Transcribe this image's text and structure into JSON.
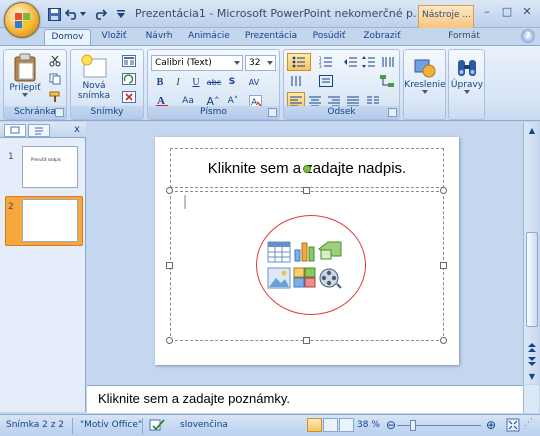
{
  "window": {
    "title": "Prezentácia1 - Microsoft PowerPoint nekomerčné p...",
    "context_tab": "Nástroje ...",
    "buttons": {
      "minimize": "–",
      "maximize": "□",
      "close": "✕"
    }
  },
  "quick_access": {
    "items": [
      "save-icon",
      "undo-icon",
      "redo-icon",
      "customize-icon"
    ]
  },
  "tabs": [
    "Domov",
    "Vložiť",
    "Návrh",
    "Animácie",
    "Prezentácia",
    "Posúdiť",
    "Zobraziť"
  ],
  "format_tab": "Formát",
  "help": "?",
  "ribbon": {
    "clipboard": {
      "label": "Schránka",
      "paste": "Prilepiť"
    },
    "slides": {
      "label": "Snímky",
      "new_slide": "Nová snímka"
    },
    "font": {
      "label": "Písmo",
      "font_name": "Calibri (Text)",
      "font_size": "32"
    },
    "paragraph": {
      "label": "Odsek"
    },
    "drawing": {
      "label": "Kreslenie"
    },
    "editing": {
      "label": "Úpravy"
    }
  },
  "slide_panel": {
    "close": "x",
    "thumb1_num": "1",
    "thumb2_num": "2",
    "thumb1_text": "Prerušiť nadpis"
  },
  "slide": {
    "title_placeholder": "Kliknite sem a zadajte nadpis."
  },
  "notes": {
    "placeholder": "Kliknite sem a zadajte poznámky."
  },
  "status": {
    "slide": "Snímka 2 z 2",
    "theme": "\"Motív Office\"",
    "language": "slovenčina",
    "zoom": "38 %"
  },
  "colors": {
    "accent": "#15428b",
    "ribbon": "#dbe7f6",
    "selected_thumb": "#f6a83e",
    "ellipse": "#e23b3b"
  }
}
